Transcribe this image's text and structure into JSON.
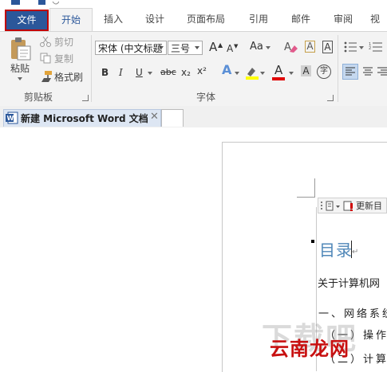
{
  "ribbon_tabs": [
    "文件",
    "开始",
    "插入",
    "设计",
    "页面布局",
    "引用",
    "邮件",
    "审阅",
    "视"
  ],
  "clipboard": {
    "paste_label": "粘贴",
    "cut_label": "剪切",
    "copy_label": "复制",
    "format_painter_label": "格式刷",
    "group_label": "剪贴板"
  },
  "font": {
    "font_name": "宋体 (中文标题",
    "font_size": "三号",
    "group_label": "字体",
    "grow_font_glyph": "A",
    "shrink_font_glyph": "A",
    "change_case_glyph": "Aa",
    "clear_format_glyph": "A",
    "char_border_glyph": "A",
    "bold_glyph": "B",
    "italic_glyph": "I",
    "underline_glyph": "U",
    "strike_glyph": "abc",
    "subscript_glyph": "x₂",
    "superscript_glyph": "x²",
    "text_effects_glyph": "A",
    "font_color_glyph": "A",
    "char_shading_glyph": "A",
    "enclose_glyph": "字",
    "highlight_color": "#ffff00",
    "font_color": "#e00000"
  },
  "document_tab": {
    "title": "新建 Microsoft Word 文档",
    "close_glyph": "✕"
  },
  "mini_toolbar": {
    "update_label": "更新目"
  },
  "document": {
    "heading": "目录",
    "para_mark": "↵",
    "line1": "关于计算机网",
    "line2": "一、网络系统",
    "line3": "（一）操作系",
    "line4": "（二）计算机"
  },
  "watermark": {
    "gray_text": "下载吧",
    "red_text": "云南龙网"
  },
  "colors": {
    "accent": "#2b579a",
    "heading": "#4f87b8",
    "file_tab_outline": "#c00000"
  }
}
